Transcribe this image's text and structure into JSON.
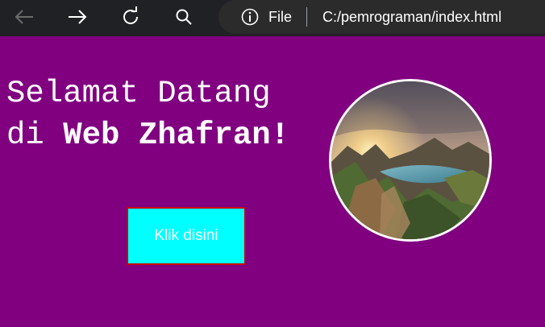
{
  "browser": {
    "icons": [
      "back-icon",
      "forward-icon",
      "refresh-icon",
      "search-icon",
      "info-icon"
    ],
    "address_scheme": "File",
    "address_url": "C:/pemrograman/index.html"
  },
  "page": {
    "heading_line1": "Selamat Datang",
    "heading_prefix": "di ",
    "heading_name": "Web Zhafran!",
    "button_label": "Klik disini",
    "hero_image": "mountain-landscape-photo"
  },
  "colors": {
    "page_background": "#800080",
    "button_background": "#00ffff",
    "button_border": "#cc0000",
    "text": "#ffffff"
  }
}
